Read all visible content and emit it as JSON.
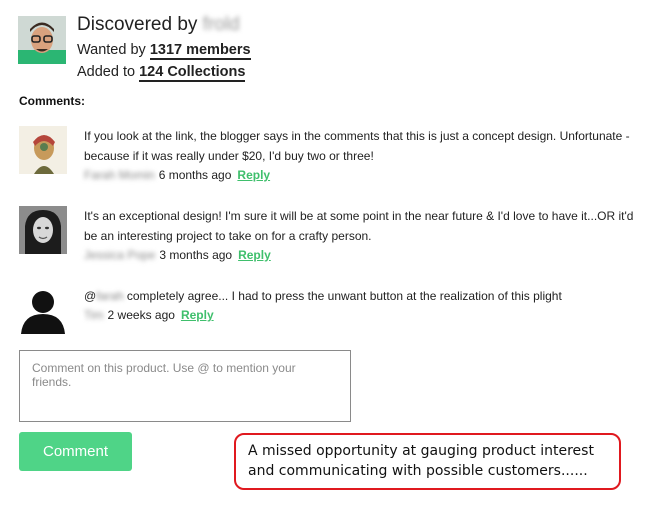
{
  "header": {
    "discovered_label": "Discovered by",
    "discoverer": "frold",
    "wanted_prefix": "Wanted by",
    "wanted_link": "1317 members",
    "added_prefix": "Added to",
    "added_link": "124 Collections"
  },
  "comments_heading": "Comments:",
  "comments": [
    {
      "text": "If you look at the link, the blogger says in the comments that this is just a concept design. Unfortunate - because if it was really under $20, I'd buy two or three!",
      "author": "Farah Momin",
      "time": "6 months ago",
      "reply": "Reply"
    },
    {
      "text": "It's an exceptional design! I'm sure it will be at some point in the near future & I'd love to have it...OR it'd be an interesting project to take on for a crafty person.",
      "author": "Jessica Pope",
      "time": "3 months ago",
      "reply": "Reply"
    },
    {
      "mention_prefix": "@",
      "mention": "farah",
      "text": " completely agree... I had to press the unwant button at the realization of this plight",
      "author": "Tim",
      "time": "2 weeks ago",
      "reply": "Reply"
    }
  ],
  "comment_input": {
    "placeholder": "Comment on this product. Use @ to mention your friends.",
    "value": ""
  },
  "comment_button": "Comment",
  "annotation": "A missed opportunity at gauging product interest and communicating with possible customers......",
  "colors": {
    "accent_green": "#4fd487",
    "reply_green": "#3fbf6c",
    "annotation_red": "#e0191f"
  }
}
